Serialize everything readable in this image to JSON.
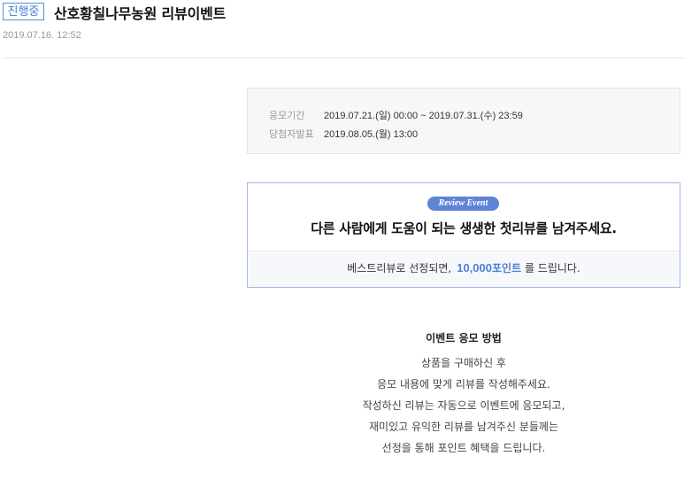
{
  "header": {
    "status_badge": "진행중",
    "title": "산호황칠나무농원 리뷰이벤트",
    "posted_at": "2019.07.16. 12:52"
  },
  "period": {
    "apply_label": "응모기간",
    "apply_value": "2019.07.21.(일) 00:00 ~ 2019.07.31.(수) 23:59",
    "announce_label": "당첨자발표",
    "announce_value": "2019.08.05.(월) 13:00"
  },
  "event": {
    "tag": "Review Event",
    "headline": "다른 사람에게 도움이 되는 생생한 첫리뷰를 남겨주세요.",
    "footer_prefix": "베스트리뷰로 선정되면,",
    "points_amount": "10,000",
    "points_unit": "포인트",
    "footer_suffix": "를 드립니다."
  },
  "how_to": {
    "title": "이벤트 응모 방법",
    "lines": [
      "상품을 구매하신 후",
      "응모 내용에 맞게 리뷰를 작성해주세요.",
      "작성하신 리뷰는 자동으로 이벤트에 응모되고,",
      "재미있고 유익한 리뷰를 남겨주신 분들께는",
      "선정을 통해 포인트 혜택을 드립니다."
    ]
  },
  "colors": {
    "accent": "#4a7fd3",
    "pill": "#5f84d6",
    "box_border": "#9fb6e6"
  }
}
